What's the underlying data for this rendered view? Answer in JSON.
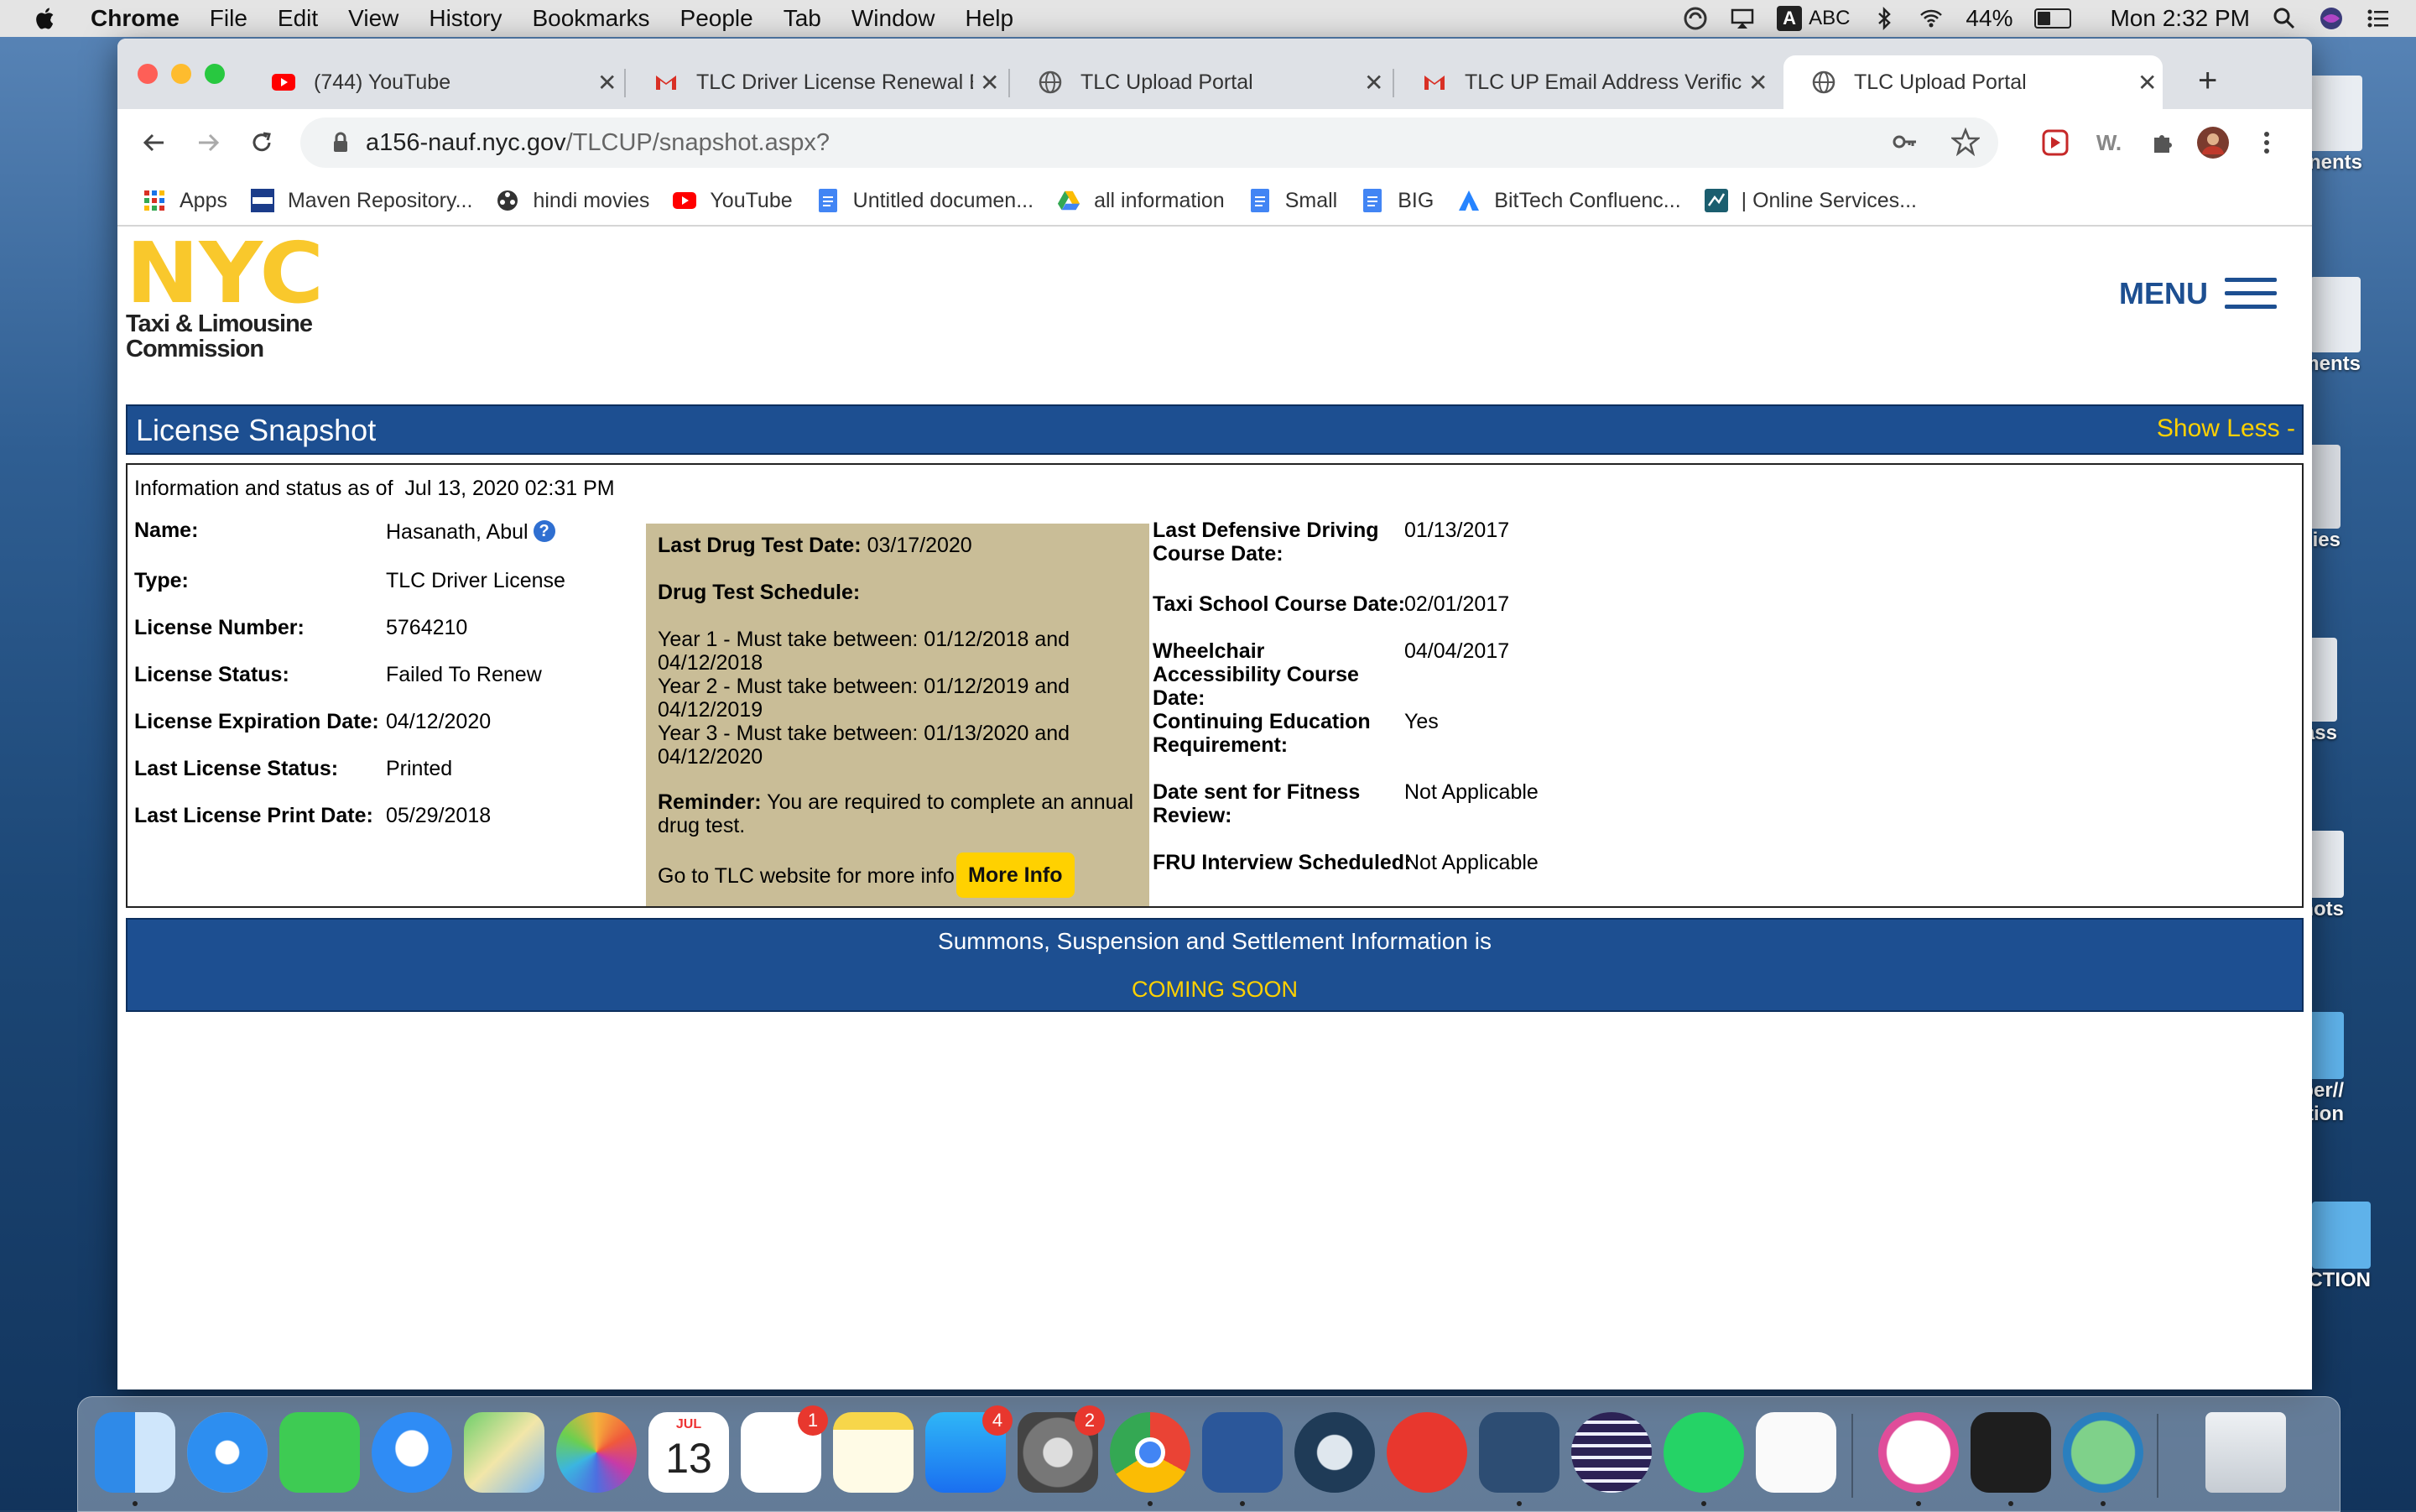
{
  "menubar": {
    "app": "Chrome",
    "items": [
      "File",
      "Edit",
      "View",
      "History",
      "Bookmarks",
      "People",
      "Tab",
      "Window",
      "Help"
    ],
    "input_source": "ABC",
    "battery_percent": "44%",
    "battery_level": 0.44,
    "clock": "Mon 2:32 PM"
  },
  "desktop": {
    "icons": [
      "nents",
      "uments",
      "ies",
      "ass",
      "shots",
      "nber//\ntion",
      "CTION"
    ],
    "folder_color": "#5fb2ea"
  },
  "tabs": [
    {
      "title": "(744) YouTube",
      "icon": "youtube-icon"
    },
    {
      "title": "TLC Driver License Renewal E",
      "icon": "gmail-icon"
    },
    {
      "title": "TLC Upload Portal",
      "icon": "globe-icon"
    },
    {
      "title": "TLC UP Email Address Verific",
      "icon": "gmail-icon"
    },
    {
      "title": "TLC Upload Portal",
      "icon": "globe-icon"
    }
  ],
  "omnibox": {
    "host": "a156-nauf.nyc.gov",
    "path": "/TLCUP/snapshot.aspx?"
  },
  "toolbar": {
    "ext_text": "W."
  },
  "bookmarks": [
    {
      "label": "Apps",
      "icon": "apps-grid-icon"
    },
    {
      "label": "Maven Repository...",
      "icon": "maven-icon"
    },
    {
      "label": "hindi movies",
      "icon": "film-reel-icon"
    },
    {
      "label": "YouTube",
      "icon": "youtube-icon"
    },
    {
      "label": "Untitled documen...",
      "icon": "docs-icon"
    },
    {
      "label": "all information",
      "icon": "drive-icon"
    },
    {
      "label": "Small",
      "icon": "docs-icon"
    },
    {
      "label": "BIG",
      "icon": "docs-icon"
    },
    {
      "label": "BitTech Confluenc...",
      "icon": "confluence-icon"
    },
    {
      "label": "| Online Services...",
      "icon": "online-services-icon"
    }
  ],
  "logo": {
    "wordmark": "NYC",
    "line1": "Taxi & Limousine",
    "line2": "Commission",
    "color": "#f9c82c"
  },
  "header": {
    "menu_label": "MENU"
  },
  "snapshot": {
    "title": "License Snapshot",
    "toggle_label": "Show Less -",
    "as_of_label": "Information and status as of",
    "as_of_value": "Jul 13, 2020 02:31 PM",
    "left": [
      {
        "label": "Name:",
        "value": "Hasanath, Abul"
      },
      {
        "label": "Type:",
        "value": "TLC Driver License"
      },
      {
        "label": "License Number:",
        "value": "5764210"
      },
      {
        "label": "License Status:",
        "value": "Failed To Renew"
      },
      {
        "label": "License Expiration Date:",
        "value": "04/12/2020"
      },
      {
        "label": "Last License Status:",
        "value": "Printed"
      },
      {
        "label": "Last License Print Date:",
        "value": "05/29/2018"
      }
    ],
    "help_icon_text": "?",
    "drug": {
      "last_label": "Last Drug Test Date:",
      "last_value": "03/17/2020",
      "schedule_label": "Drug Test Schedule:",
      "years": [
        "Year 1 - Must take between: 01/12/2018 and 04/12/2018",
        "Year 2 - Must take between: 01/12/2019 and 04/12/2019",
        "Year 3 - Must take between: 01/13/2020 and 04/12/2020"
      ],
      "reminder_label": "Reminder:",
      "reminder_text": "You are required to complete an annual drug test.",
      "goto_text": "Go to TLC website for more info:",
      "more_info_label": "More Info",
      "panel_color": "#c9bd97"
    },
    "right": [
      {
        "label": "Last Defensive Driving Course Date:",
        "value": "01/13/2017"
      },
      {
        "label": "Taxi School Course Date:",
        "value": "02/01/2017"
      },
      {
        "label": "Wheelchair Accessibility Course Date:",
        "value": "04/04/2017"
      },
      {
        "label": "Continuing Education Requirement:",
        "value": "Yes"
      },
      {
        "label": "Date sent for Fitness Review:",
        "value": "Not Applicable"
      },
      {
        "label": "FRU Interview Scheduled:",
        "value": "Not Applicable"
      }
    ]
  },
  "summons": {
    "line1": "Summons, Suspension and Settlement Information is",
    "line2": "COMING SOON"
  },
  "colors": {
    "nyc_blue": "#1d4f91",
    "accent_yellow": "#ffd100"
  },
  "dock": {
    "calendar_month": "JUL",
    "calendar_day": "13",
    "reminders_badge": "1",
    "appstore_badge": "4",
    "prefs_badge": "2"
  }
}
